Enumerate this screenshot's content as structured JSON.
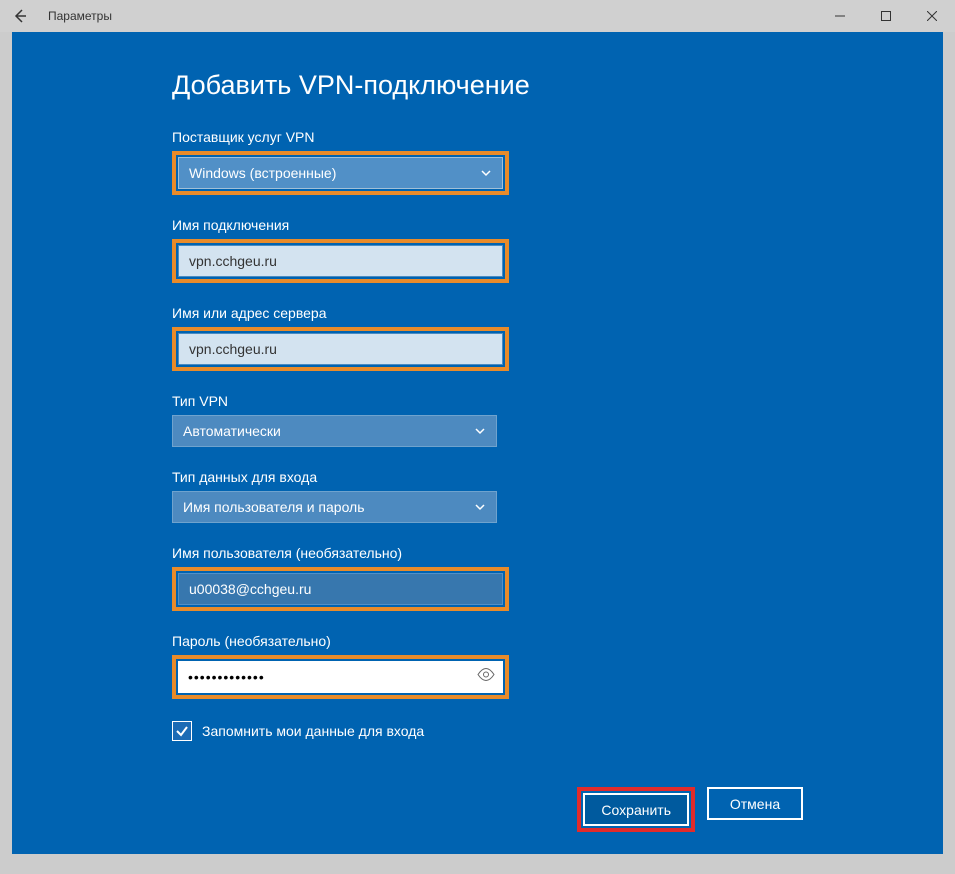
{
  "titlebar": {
    "title": "Параметры"
  },
  "page": {
    "title": "Добавить VPN-подключение"
  },
  "fields": {
    "provider": {
      "label": "Поставщик услуг VPN",
      "value": "Windows (встроенные)"
    },
    "connectionName": {
      "label": "Имя подключения",
      "value": "vpn.cchgeu.ru"
    },
    "serverAddress": {
      "label": "Имя или адрес сервера",
      "value": "vpn.cchgeu.ru"
    },
    "vpnType": {
      "label": "Тип VPN",
      "value": "Автоматически"
    },
    "signInType": {
      "label": "Тип данных для входа",
      "value": "Имя пользователя и пароль"
    },
    "username": {
      "label": "Имя пользователя (необязательно)",
      "value": "u00038@cchgeu.ru"
    },
    "password": {
      "label": "Пароль (необязательно)",
      "value": "•••••••••••••"
    }
  },
  "checkbox": {
    "label": "Запомнить мои данные для входа",
    "checked": true
  },
  "buttons": {
    "save": "Сохранить",
    "cancel": "Отмена"
  }
}
